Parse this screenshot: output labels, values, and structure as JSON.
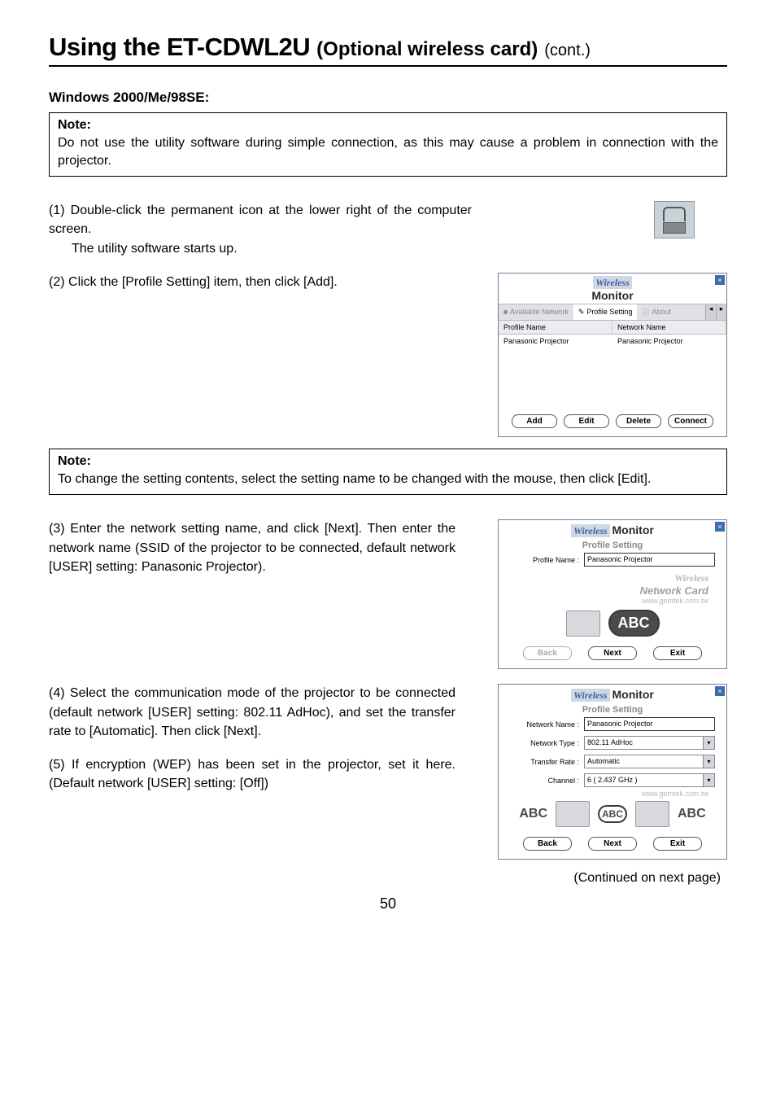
{
  "title_main": "Using the ET-CDWL2U",
  "title_sub": "(Optional wireless card)",
  "title_cont": "(cont.)",
  "os_heading": "Windows 2000/Me/98SE:",
  "note1": {
    "label": "Note:",
    "body": "Do not use the utility software during simple connection, as this may cause a problem in connection with the projector."
  },
  "steps": {
    "s1_num": "(1)",
    "s1_line1": "Double-click the permanent icon at the lower right of the computer screen.",
    "s1_line2": "The utility software starts up.",
    "s2_num": "(2)",
    "s2_body": "Click the [Profile Setting] item, then click [Add].",
    "s3_num": "(3)",
    "s3_body": "Enter the network setting name, and click [Next]. Then enter the network name (SSID of the projector to be connected, default network [USER] setting: Panasonic Projector).",
    "s4_num": "(4)",
    "s4_body": "Select the communication mode of the projector to be connected (default network [USER] setting: 802.11 AdHoc), and set the transfer rate to [Automatic]. Then click [Next].",
    "s5_num": "(5)",
    "s5_body": "If encryption (WEP) has been set in the projector, set it here. (Default network [USER] setting: [Off])"
  },
  "note2": {
    "label": "Note:",
    "body": "To change the setting contents, select the setting name to be changed with the mouse, then click [Edit]."
  },
  "dialog_list": {
    "brand1": "Wireless",
    "brand2": "Monitor",
    "tab_available": "Available Network",
    "tab_profile": "Profile Setting",
    "tab_about": "About",
    "col_profile": "Profile Name",
    "col_network": "Network Name",
    "row_profile": "Panasonic Projector",
    "row_network": "Panasonic Projector",
    "btn_add": "Add",
    "btn_edit": "Edit",
    "btn_delete": "Delete",
    "btn_connect": "Connect"
  },
  "dialog_name": {
    "brand1": "Wireless",
    "brand2": "Monitor",
    "sub": "Profile Setting",
    "label_profile_name": "Profile Name :",
    "value_profile_name": "Panasonic Projector",
    "card_l1": "Wireless",
    "card_l2": "Network Card",
    "card_l3": "www.gemtek.com.tw",
    "abc": "ABC",
    "btn_back": "Back",
    "btn_next": "Next",
    "btn_exit": "Exit"
  },
  "dialog_mode": {
    "brand1": "Wireless",
    "brand2": "Monitor",
    "sub": "Profile Setting",
    "label_network_name": "Network Name :",
    "value_network_name": "Panasonic Projector",
    "label_network_type": "Network Type :",
    "value_network_type": "802.11 AdHoc",
    "label_transfer_rate": "Transfer Rate :",
    "value_transfer_rate": "Automatic",
    "label_channel": "Channel :",
    "value_channel": "6 ( 2.437 GHz )",
    "card_l3": "www.gemtek.com.tw",
    "abc_left": "ABC",
    "abc_mid": "ABC",
    "abc_right": "ABC",
    "btn_back": "Back",
    "btn_next": "Next",
    "btn_exit": "Exit"
  },
  "continued": "(Continued on next page)",
  "page_number": "50"
}
